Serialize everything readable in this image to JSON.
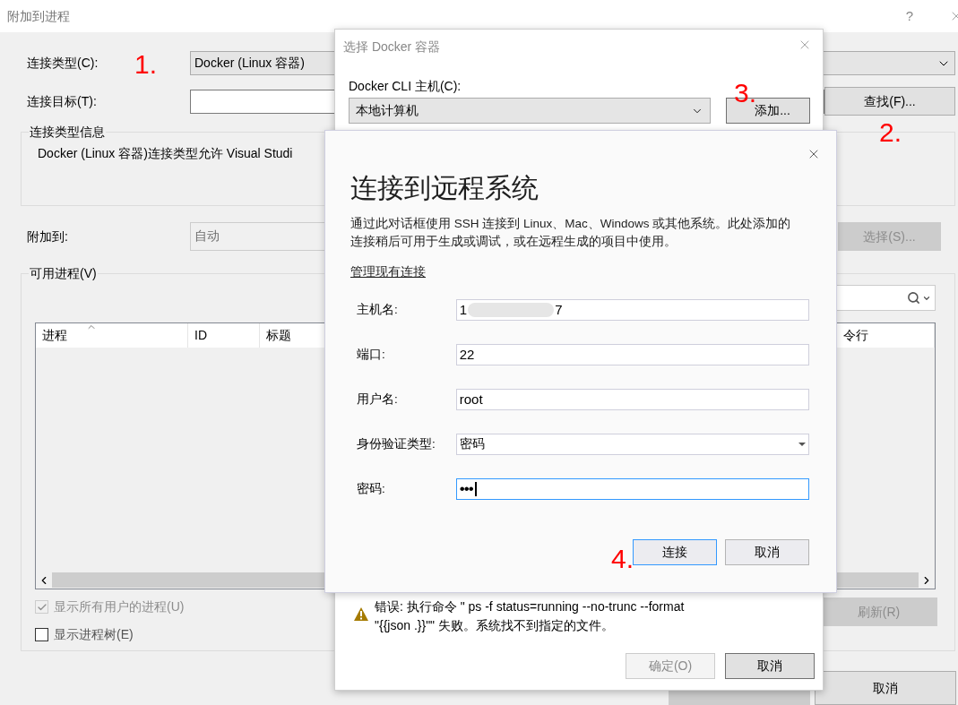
{
  "window": {
    "title": "附加到进程",
    "help": "?"
  },
  "connection_type": {
    "label": "连接类型(C):",
    "value": "Docker (Linux 容器)"
  },
  "connection_target": {
    "label": "连接目标(T):",
    "button": "查找(F)..."
  },
  "info_group": {
    "title": "连接类型信息",
    "text": "Docker (Linux 容器)连接类型允许 Visual Studi"
  },
  "attach_to": {
    "label": "附加到:",
    "value": "自动",
    "disabled": true,
    "button": {
      "label": "选择(S)...",
      "disabled": true
    }
  },
  "processes": {
    "title": "可用进程(V)",
    "columns": [
      {
        "label": "进程",
        "sorted": true
      },
      {
        "label": "ID",
        "sorted": false
      },
      {
        "label": "标题",
        "sorted": false
      },
      {
        "label": "令行",
        "sorted": false
      }
    ],
    "options": [
      {
        "label": "显示所有用户的进程(U)",
        "checked": true,
        "disabled": true
      },
      {
        "label": "显示进程树(E)",
        "checked": false,
        "disabled": false
      }
    ],
    "refresh": {
      "label": "刷新(R)",
      "disabled": true
    }
  },
  "footer": [
    {
      "disabled": true
    },
    {
      "label": "取消",
      "disabled": false
    }
  ],
  "docker_dialog": {
    "title": "选择 Docker 容器",
    "host_label": "Docker CLI 主机(C):",
    "host_value": "本地计算机",
    "add_button": "添加...",
    "error_lines": [
      "错误: 执行命令 \" ps -f status=running --no-trunc --format",
      "\"{{json .}}\"\" 失败。系统找不到指定的文件。"
    ],
    "buttons": [
      {
        "label": "确定(O)",
        "disabled": true
      },
      {
        "label": "取消",
        "disabled": false
      }
    ]
  },
  "ssh_dialog": {
    "title": "连接到远程系统",
    "description": "通过此对话框使用 SSH 连接到 Linux、Mac、Windows 或其他系统。此处添加的连接稍后可用于生成或调试，或在远程生成的项目中使用。",
    "manage_link": "管理现有连接",
    "fields": [
      {
        "kind": "redacted",
        "label": "主机名:",
        "value_start": "1",
        "value_end": "7",
        "focused": false
      },
      {
        "kind": "text",
        "label": "端口:",
        "value": "22",
        "focused": false
      },
      {
        "kind": "text",
        "label": "用户名:",
        "value": "root",
        "focused": false
      },
      {
        "kind": "select",
        "label": "身份验证类型:",
        "value": "密码",
        "focused": false
      },
      {
        "kind": "password",
        "label": "密码:",
        "value": "•••",
        "focused": true
      }
    ],
    "buttons": [
      {
        "label": "连接",
        "focused": true
      },
      {
        "label": "取消",
        "focused": false
      }
    ]
  },
  "annotations": [
    {
      "text": "1."
    },
    {
      "text": "2."
    },
    {
      "text": "3."
    },
    {
      "text": "4."
    }
  ]
}
